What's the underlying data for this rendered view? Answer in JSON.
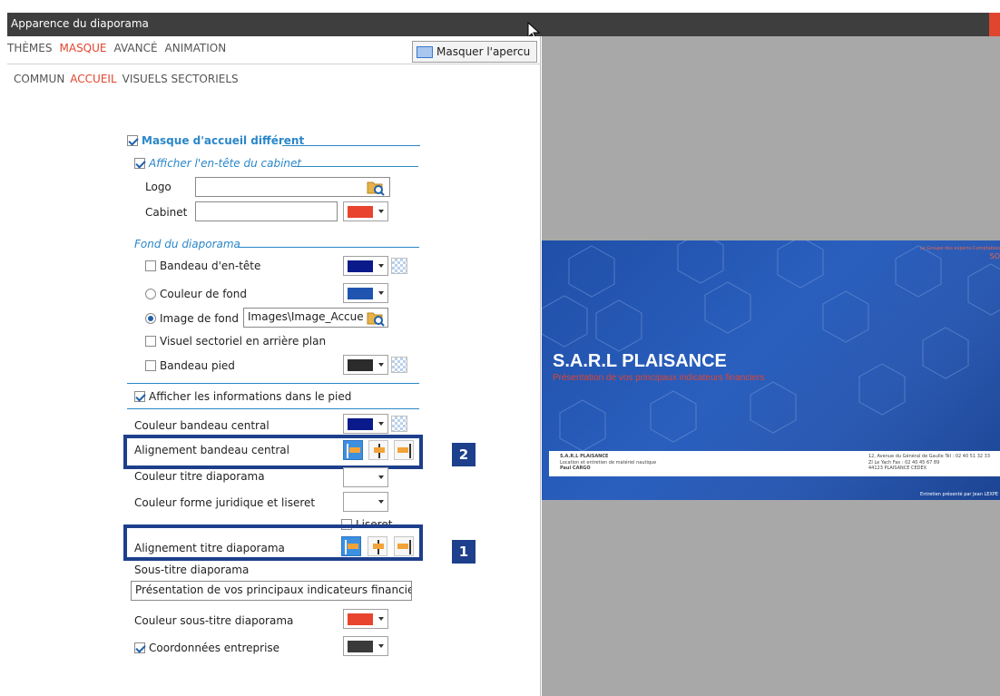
{
  "window": {
    "title": "Apparence du diaporama"
  },
  "tabs_main": [
    {
      "label": "THÈMES",
      "active": false
    },
    {
      "label": "MASQUE",
      "active": true
    },
    {
      "label": "AVANCÉ",
      "active": false
    },
    {
      "label": "ANIMATION",
      "active": false
    }
  ],
  "preview_button": {
    "label": "Masquer l'apercu"
  },
  "tabs_sub": [
    {
      "label": "COMMUN",
      "active": false
    },
    {
      "label": "ACCUEIL",
      "active": true
    },
    {
      "label": "VISUELS SECTORIELS",
      "active": false
    }
  ],
  "form": {
    "masque_accueil": "Masque d'accueil différent",
    "afficher_entete": "Afficher l'en-tête du cabinet",
    "logo_label": "Logo",
    "cabinet_label": "Cabinet",
    "fond_section": "Fond du diaporama",
    "bandeau_entete": "Bandeau d'en-tête",
    "couleur_fond": "Couleur de fond",
    "image_fond": "Image de fond",
    "image_fond_value": "Images\\Image_Accue",
    "visuel_sectoriel": "Visuel sectoriel en arrière plan",
    "bandeau_pied": "Bandeau pied",
    "afficher_infos_pied": "Afficher les informations dans le pied",
    "couleur_bandeau_central": "Couleur bandeau central",
    "alignement_bandeau_central": "Alignement bandeau central",
    "couleur_titre": "Couleur titre diaporama",
    "couleur_forme_juridique": "Couleur forme juridique et liseret",
    "liseret": "Liseret",
    "alignement_titre": "Alignement titre diaporama",
    "sous_titre_label": "Sous-titre diaporama",
    "sous_titre_value": "Présentation de vos principaux indicateurs financier",
    "couleur_sous_titre": "Couleur sous-titre diaporama",
    "coordonnees": "Coordonnées entreprise"
  },
  "colors": {
    "cabinet": "#e8442e",
    "bandeau_entete": "#0a1a8a",
    "couleur_fond": "#1f55b0",
    "bandeau_pied": "#2b2b2b",
    "bandeau_central": "#0a1a8a",
    "sous_titre": "#e8442e",
    "coordonnees": "#3a3a3a",
    "callout": "#1d3f8c",
    "accent": "#e0452f"
  },
  "badges": {
    "one": "1",
    "two": "2"
  },
  "preview": {
    "title": "S.A.R.L PLAISANCE",
    "subtitle": "Présentation de vos principaux indicateurs financiers",
    "top_right_1": "Le Groupe des experts-Comptables",
    "top_right_2": "SO",
    "band_left_1": "S.A.R.L PLAISANCE",
    "band_left_2": "Location et entretien de matériel nautique",
    "band_left_3": "Paul CARGO",
    "band_right_1": "12, Avenue du Général de Gaulle   Tél : 02 40 51 32 33",
    "band_right_2": "ZI Le Yach                         Fax : 02 40 45 67 89",
    "band_right_3": "44123 PLAISANCE CEDEX",
    "footer": "Entretien présenté par Jean LEXPE"
  }
}
